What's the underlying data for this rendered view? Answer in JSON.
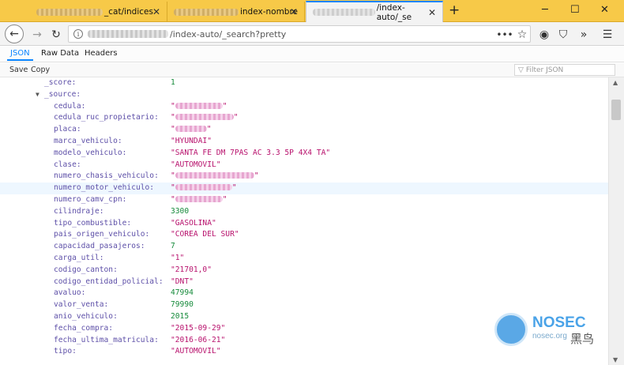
{
  "tabs": [
    {
      "label": "_cat/indices",
      "active": false
    },
    {
      "label": "index-nombre",
      "active": false
    },
    {
      "label": "/index-auto/_se",
      "active": true
    }
  ],
  "nav": {
    "url_suffix": "/index-auto/_search?pretty"
  },
  "viewer_tabs": [
    "JSON",
    "Raw Data",
    "Headers"
  ],
  "toolbar": {
    "save": "Save",
    "copy": "Copy",
    "filter_placeholder": "Filter JSON"
  },
  "json": {
    "score_key": "_score:",
    "score_val": "1",
    "source_key": "_source:",
    "rows": [
      {
        "key": "cedula:",
        "val": "",
        "type": "redacted"
      },
      {
        "key": "cedula_ruc_propietario:",
        "val": "",
        "type": "redacted"
      },
      {
        "key": "placa:",
        "val": "",
        "type": "redacted"
      },
      {
        "key": "marca_vehiculo:",
        "val": "\"HYUNDAI\"",
        "type": "str"
      },
      {
        "key": "modelo_vehiculo:",
        "val": "\"SANTA FE DM 7PAS AC 3.3 5P 4X4 TA\"",
        "type": "str"
      },
      {
        "key": "clase:",
        "val": "\"AUTOMOVIL\"",
        "type": "str"
      },
      {
        "key": "numero_chasis_vehiculo:",
        "val": "",
        "type": "redacted"
      },
      {
        "key": "numero_motor_vehiculo:",
        "val": "",
        "type": "redacted"
      },
      {
        "key": "numero_camv_cpn:",
        "val": "",
        "type": "redacted"
      },
      {
        "key": "cilindraje:",
        "val": "3300",
        "type": "num"
      },
      {
        "key": "tipo_combustible:",
        "val": "\"GASOLINA\"",
        "type": "str"
      },
      {
        "key": "pais_origen_vehiculo:",
        "val": "\"COREA DEL SUR\"",
        "type": "str"
      },
      {
        "key": "capacidad_pasajeros:",
        "val": "7",
        "type": "num"
      },
      {
        "key": "carga_util:",
        "val": "\"1\"",
        "type": "str"
      },
      {
        "key": "codigo_canton:",
        "val": "\"21701,0\"",
        "type": "str"
      },
      {
        "key": "codigo_entidad_policial:",
        "val": "\"DNT\"",
        "type": "str"
      },
      {
        "key": "avaluo:",
        "val": "47994",
        "type": "num"
      },
      {
        "key": "valor_venta:",
        "val": "79990",
        "type": "num"
      },
      {
        "key": "anio_vehiculo:",
        "val": "2015",
        "type": "num"
      },
      {
        "key": "fecha_compra:",
        "val": "\"2015-09-29\"",
        "type": "str"
      },
      {
        "key": "fecha_ultima_matricula:",
        "val": "\"2016-06-21\"",
        "type": "str"
      },
      {
        "key": "tipo:",
        "val": "\"AUTOMOVIL\"",
        "type": "str"
      }
    ]
  },
  "watermark": {
    "brand": "NOSEC",
    "sub": "nosec.org",
    "cn": "黑鸟"
  },
  "colors": {
    "tabbar": "#f7c948",
    "accent": "#0a84ff",
    "key": "#5e50a8",
    "string": "#b8126d",
    "number": "#158a3a"
  }
}
